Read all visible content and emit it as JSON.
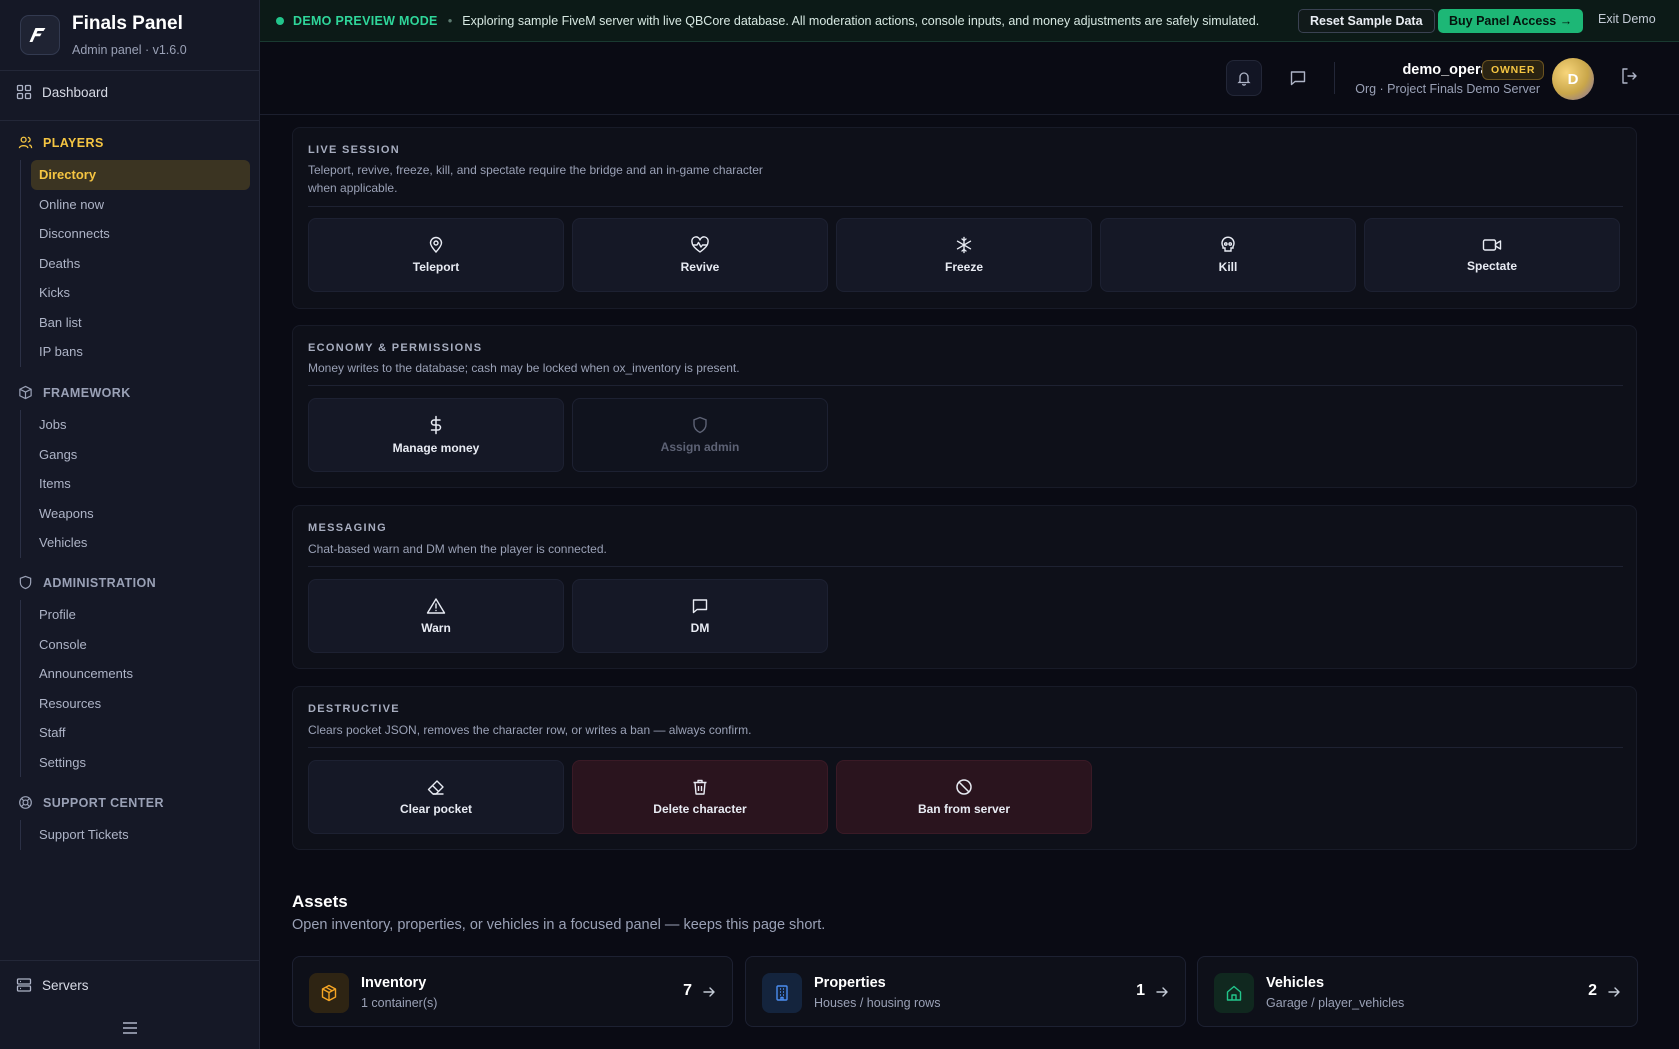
{
  "brand": {
    "title": "Finals Panel",
    "subtitle": "Admin panel · v1.6.0",
    "logo_letter": "F"
  },
  "sidebar": {
    "dashboard": "Dashboard",
    "players": {
      "label": "PLAYERS",
      "items": [
        "Directory",
        "Online now",
        "Disconnects",
        "Deaths",
        "Kicks",
        "Ban list",
        "IP bans"
      ],
      "active": "Directory"
    },
    "framework": {
      "label": "FRAMEWORK",
      "items": [
        "Jobs",
        "Gangs",
        "Items",
        "Weapons",
        "Vehicles"
      ]
    },
    "administration": {
      "label": "ADMINISTRATION",
      "items": [
        "Profile",
        "Console",
        "Announcements",
        "Resources",
        "Staff",
        "Settings"
      ]
    },
    "support": {
      "label": "SUPPORT CENTER",
      "items": [
        "Support Tickets"
      ]
    },
    "servers": "Servers"
  },
  "banner": {
    "label": "DEMO PREVIEW MODE",
    "message": "Exploring sample FiveM server with live QBCore database. All moderation actions, console inputs, and money adjustments are safely simulated.",
    "reset": "Reset Sample Data",
    "buy": "Buy Panel Access →",
    "exit": "Exit Demo"
  },
  "header": {
    "username": "demo_operator",
    "role": "OWNER",
    "org": "Org · Project Finals Demo Server",
    "avatar_letter": "D"
  },
  "panels": {
    "live": {
      "title": "LIVE SESSION",
      "desc": "Teleport, revive, freeze, kill, and spectate require the bridge and an in-game character when applicable.",
      "actions": [
        "Teleport",
        "Revive",
        "Freeze",
        "Kill",
        "Spectate"
      ]
    },
    "economy": {
      "title": "ECONOMY & PERMISSIONS",
      "desc": "Money writes to the database; cash may be locked when ox_inventory is present.",
      "actions": [
        "Manage money",
        "Assign admin"
      ]
    },
    "messaging": {
      "title": "MESSAGING",
      "desc": "Chat-based warn and DM when the player is connected.",
      "actions": [
        "Warn",
        "DM"
      ]
    },
    "destructive": {
      "title": "DESTRUCTIVE",
      "desc": "Clears pocket JSON, removes the character row, or writes a ban — always confirm.",
      "actions": [
        "Clear pocket",
        "Delete character",
        "Ban from server"
      ]
    }
  },
  "assets": {
    "title": "Assets",
    "desc": "Open inventory, properties, or vehicles in a focused panel — keeps this page short.",
    "cards": [
      {
        "name": "Inventory",
        "sub": "1 container(s)",
        "count": "7"
      },
      {
        "name": "Properties",
        "sub": "Houses / housing rows",
        "count": "1"
      },
      {
        "name": "Vehicles",
        "sub": "Garage / player_vehicles",
        "count": "2"
      }
    ]
  },
  "colors": {
    "accent": "#f5c542",
    "demo": "#22c58b",
    "buy": "#1db776",
    "danger_tile": "#2a141e"
  }
}
